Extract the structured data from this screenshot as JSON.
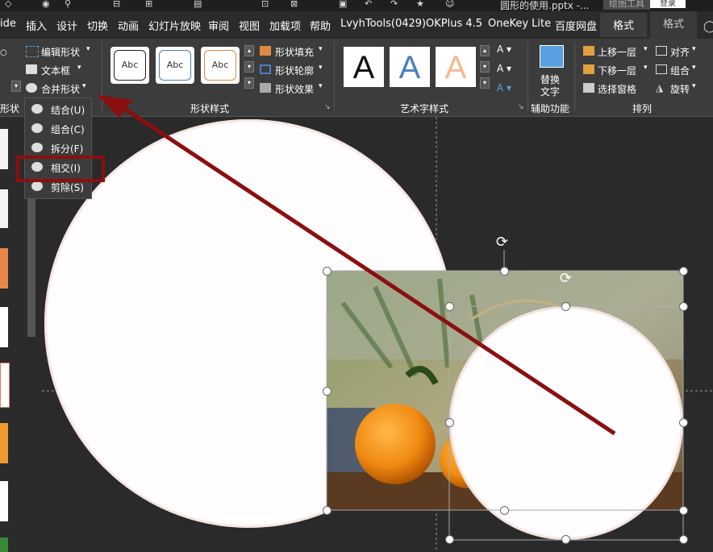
{
  "title_bar": {
    "document_title": "圆形的使用.pptx  -...",
    "drawing_tools_label": "绘图工具",
    "login_label": "登录"
  },
  "tabs": [
    {
      "label": "ide"
    },
    {
      "label": "插入"
    },
    {
      "label": "设计"
    },
    {
      "label": "切换"
    },
    {
      "label": "动画"
    },
    {
      "label": "幻灯片放映"
    },
    {
      "label": "审阅"
    },
    {
      "label": "视图"
    },
    {
      "label": "加载项"
    },
    {
      "label": "帮助"
    },
    {
      "label": "LvyhTools(0429)"
    },
    {
      "label": "OKPlus 4.5"
    },
    {
      "label": "OneKey Lite"
    },
    {
      "label": "百度网盘"
    },
    {
      "label": "格式"
    },
    {
      "label": "格式"
    }
  ],
  "ribbon": {
    "insert_shapes": {
      "edit_shape": "编辑形状",
      "text_box": "文本框",
      "merge_shapes": "合并形状",
      "group_label": "形状"
    },
    "shape_styles": {
      "sample_text": "Abc",
      "fill": "形状填充",
      "outline": "形状轮廓",
      "effects": "形状效果",
      "group_label": "形状样式"
    },
    "wordart": {
      "letter": "A",
      "group_label": "艺术字样式"
    },
    "accessibility": {
      "alt_text_line1": "替换",
      "alt_text_line2": "文字",
      "group_label": "辅助功能"
    },
    "arrange": {
      "bring_forward": "上移一层",
      "send_backward": "下移一层",
      "selection_pane": "选择窗格",
      "align": "对齐",
      "group": "组合",
      "rotate": "旋转",
      "group_label": "排列"
    }
  },
  "merge_menu": {
    "items": [
      {
        "label": "结合(U)"
      },
      {
        "label": "组合(C)"
      },
      {
        "label": "拆分(F)"
      },
      {
        "label": "相交(I)"
      },
      {
        "label": "剪除(S)"
      }
    ],
    "highlighted": "相交(I)"
  },
  "colors": {
    "ribbon_bg": "#3c3c3c",
    "highlight_box": "#8b0f0f",
    "arrow": "#8b0f0f",
    "circle_fill": "#fffdfd"
  }
}
